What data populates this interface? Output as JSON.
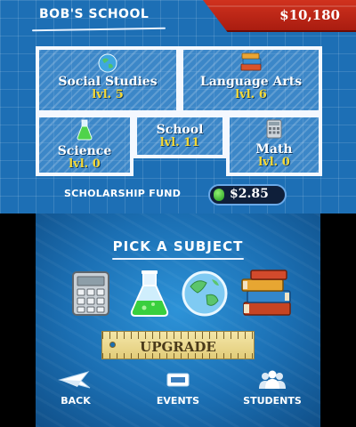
{
  "top": {
    "school_name": "BOB'S SCHOOL",
    "money": "$10,180",
    "rooms": {
      "social": {
        "name": "Social Studies",
        "level": "lvl. 5"
      },
      "language": {
        "name": "Language Arts",
        "level": "lvl. 6"
      },
      "science": {
        "name": "Science",
        "level": "lvl. 0"
      },
      "school": {
        "name": "School",
        "level": "lvl. 11"
      },
      "math": {
        "name": "Math",
        "level": "lvl. 0"
      }
    },
    "scholarship_label": "SCHOLARSHIP FUND",
    "scholarship_amount": "$2.85"
  },
  "bottom": {
    "title": "PICK A SUBJECT",
    "subjects": [
      "calculator-icon",
      "flask-icon",
      "globe-icon",
      "books-icon"
    ],
    "upgrade_label": "UPGRADE",
    "nav": {
      "back": "BACK",
      "events": "EVENTS",
      "students": "STUDENTS"
    }
  },
  "colors": {
    "top_bg": "#1d6fb5",
    "banner": "#c02a18",
    "level_text": "#f5d935",
    "bottom_bg": "#1b6fb3"
  }
}
